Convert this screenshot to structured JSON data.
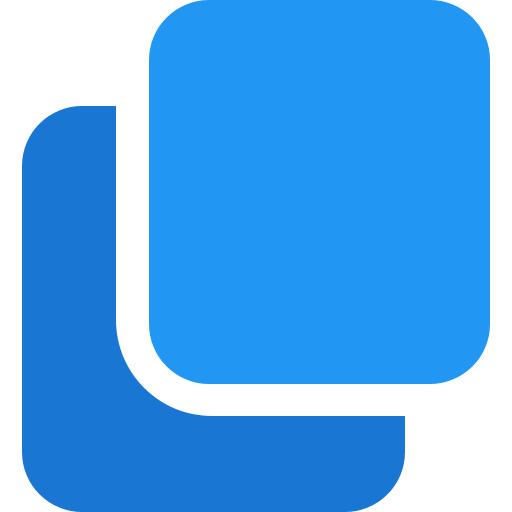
{
  "icon": {
    "name": "copy-icon",
    "colors": {
      "back_square": "#1976D2",
      "front_square": "#2196F3",
      "background": "#FFFFFF"
    }
  }
}
